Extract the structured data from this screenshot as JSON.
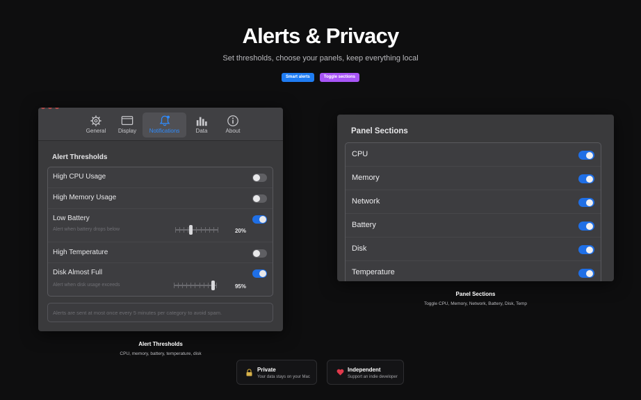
{
  "hero": {
    "title": "Alerts & Privacy",
    "subtitle": "Set thresholds, choose your panels, keep everything local",
    "pills": [
      "Smart alerts",
      "Toggle sections"
    ]
  },
  "settings_window": {
    "tabs": [
      {
        "label": "General",
        "icon": "gear-icon"
      },
      {
        "label": "Display",
        "icon": "display-icon"
      },
      {
        "label": "Notifications",
        "icon": "bell-icon",
        "active": true
      },
      {
        "label": "Data",
        "icon": "chart-icon"
      },
      {
        "label": "About",
        "icon": "info-icon"
      }
    ],
    "section_title": "Alert Thresholds",
    "rows": [
      {
        "label": "High CPU Usage",
        "enabled": false
      },
      {
        "label": "High Memory Usage",
        "enabled": false
      },
      {
        "label": "Low Battery",
        "enabled": true,
        "hint": "Alert when battery drops below",
        "value": "20%",
        "level": 0.35
      },
      {
        "label": "High Temperature",
        "enabled": false
      },
      {
        "label": "Disk Almost Full",
        "enabled": true,
        "hint": "Alert when disk usage exceeds",
        "value": "95%",
        "level": 0.95
      }
    ],
    "note": "Alerts are sent at most once every 5 minutes per category to avoid spam."
  },
  "captions": {
    "left_title": "Alert Thresholds",
    "left_sub": "CPU, memory, battery, temperature, disk",
    "right_title": "Panel Sections",
    "right_sub": "Toggle CPU, Memory, Network, Battery, Disk, Temp"
  },
  "panel_sections": {
    "title": "Panel Sections",
    "items": [
      {
        "label": "CPU",
        "enabled": true
      },
      {
        "label": "Memory",
        "enabled": true
      },
      {
        "label": "Network",
        "enabled": true
      },
      {
        "label": "Battery",
        "enabled": true
      },
      {
        "label": "Disk",
        "enabled": true
      },
      {
        "label": "Temperature",
        "enabled": true
      }
    ]
  },
  "footer": {
    "cards": [
      {
        "icon": "lock-icon",
        "title": "Private",
        "subtitle": "Your data stays on your Mac"
      },
      {
        "icon": "heart-icon",
        "title": "Independent",
        "subtitle": "Support an indie developer"
      }
    ]
  },
  "colors": {
    "accent": "#1f6fe6",
    "pill_blue": "#1f7cf2",
    "pill_purple": "#a855f7",
    "background": "#0e0e0f"
  }
}
